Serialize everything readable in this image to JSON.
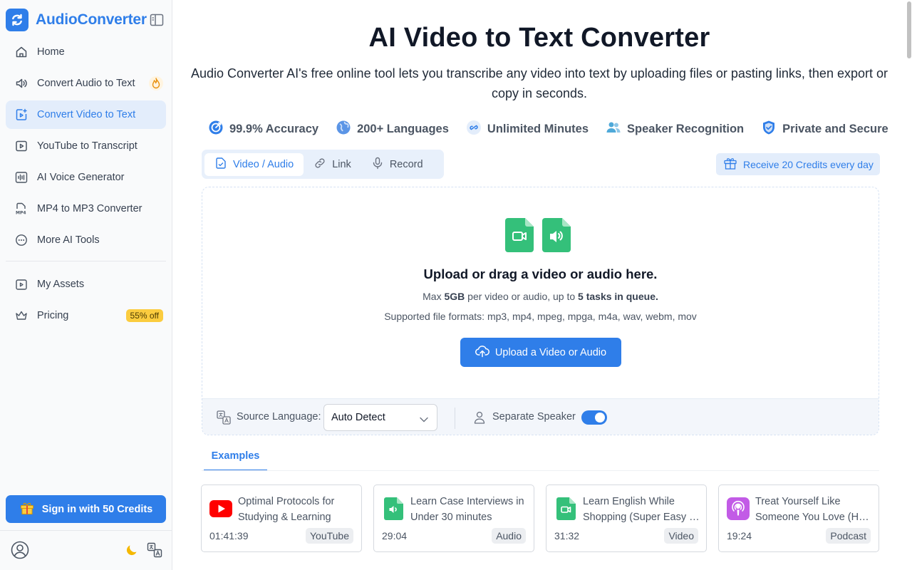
{
  "brand": {
    "name": "AudioConverter"
  },
  "sidebar": {
    "items": [
      {
        "label": "Home",
        "icon": "home-icon"
      },
      {
        "label": "Convert Audio to Text",
        "icon": "speaker-icon"
      },
      {
        "label": "Convert Video to Text",
        "icon": "video-file-icon",
        "active": true
      },
      {
        "label": "YouTube to Transcript",
        "icon": "youtube-icon"
      },
      {
        "label": "AI Voice Generator",
        "icon": "waveform-icon"
      },
      {
        "label": "MP4 to MP3 Converter",
        "icon": "mp4-icon"
      },
      {
        "label": "More AI Tools",
        "icon": "more-icon"
      }
    ],
    "secondary": [
      {
        "label": "My Assets",
        "icon": "assets-icon"
      },
      {
        "label": "Pricing",
        "icon": "crown-icon",
        "badge": "55% off"
      }
    ],
    "signin_label": "Sign in with 50 Credits"
  },
  "main": {
    "title": "AI Video to Text Converter",
    "subtitle": "Audio Converter AI's free online tool lets you transcribe any video into text by uploading files or pasting links, then export or copy in seconds.",
    "features": [
      {
        "label": "99.9% Accuracy",
        "icon": "accuracy-icon"
      },
      {
        "label": "200+ Languages",
        "icon": "globe-icon"
      },
      {
        "label": "Unlimited Minutes",
        "icon": "infinity-icon"
      },
      {
        "label": "Speaker Recognition",
        "icon": "users-icon"
      },
      {
        "label": "Private and Secure",
        "icon": "shield-icon"
      }
    ],
    "tabs": [
      {
        "label": "Video / Audio",
        "active": true
      },
      {
        "label": "Link"
      },
      {
        "label": "Record"
      }
    ],
    "credits_label": "Receive 20 Credits every day",
    "upload": {
      "title": "Upload or drag a video or audio here.",
      "max_prefix": "Max ",
      "max_size": "5GB",
      "max_middle": " per video or audio, up to ",
      "max_tasks": "5 tasks in queue.",
      "formats": "Supported file formats: mp3, mp4, mpeg, mpga, m4a, wav, webm, mov",
      "button_label": "Upload a Video or Audio"
    },
    "options": {
      "source_language_label": "Source Language:",
      "source_language_value": "Auto Detect",
      "separate_speaker_label": "Separate Speaker",
      "separate_speaker_on": true
    },
    "examples_tab": "Examples",
    "examples": [
      {
        "title_line1": "Optimal Protocols for",
        "title_line2": "Studying & Learning",
        "duration": "01:41:39",
        "tag": "YouTube",
        "icon": "youtube-icon"
      },
      {
        "title_line1": "Learn Case Interviews in",
        "title_line2": "Under 30 minutes",
        "duration": "29:04",
        "tag": "Audio",
        "icon": "audio-file-icon"
      },
      {
        "title_line1": "Learn English While",
        "title_line2": "Shopping (Super Easy f…",
        "duration": "31:32",
        "tag": "Video",
        "icon": "video-file-icon"
      },
      {
        "title_line1": "Treat Yourself Like",
        "title_line2": "Someone You Love (Ho…",
        "duration": "19:24",
        "tag": "Podcast",
        "icon": "podcast-icon"
      }
    ]
  },
  "colors": {
    "accent": "#2f7ee9",
    "green": "#34c07a",
    "badge": "#fbcc3f",
    "youtube": "#ff0000",
    "podcast": "#c25be6"
  }
}
